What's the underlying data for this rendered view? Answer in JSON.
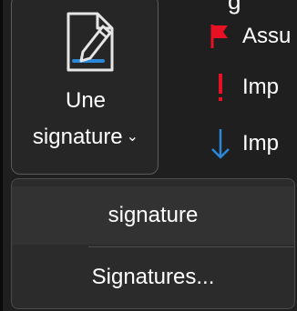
{
  "ribbon": {
    "top_partial_text": "g",
    "signature_button": {
      "label_line1": "Une",
      "label_line2": "signature",
      "icon": "signature-pen-icon",
      "dropdown_icon": "chevron-down-icon"
    },
    "commands": [
      {
        "icon": "red-flag-icon",
        "label": "Assu",
        "color": "#e81123"
      },
      {
        "icon": "exclamation-icon",
        "label": "Imp",
        "color": "#e81123"
      },
      {
        "icon": "down-arrow-icon",
        "label": "Imp",
        "color": "#2b88d8"
      }
    ]
  },
  "menu": {
    "items": [
      {
        "label": "signature"
      },
      {
        "label": "Signatures..."
      }
    ]
  },
  "colors": {
    "background": "#1f1f1f",
    "accent_blue": "#2b88d8",
    "flag_red": "#e81123"
  }
}
